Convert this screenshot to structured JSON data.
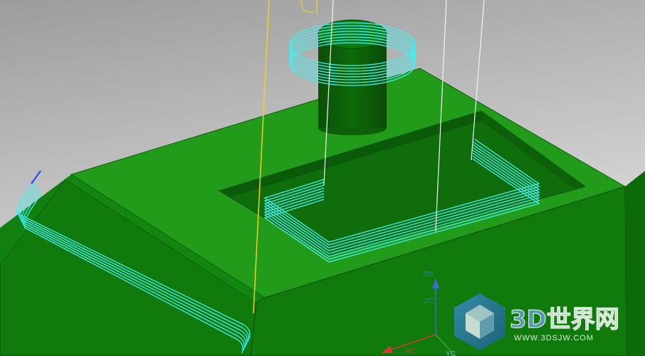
{
  "viewport": {
    "axes": {
      "zm_label": "ZM",
      "zc_label": "ZC",
      "xc_label": "XC",
      "yc_label": "YC",
      "z_color": "#3a6fd0",
      "x_color": "#d03a3a"
    },
    "colors": {
      "background_top": "#9e9e9e",
      "background_bottom": "#e2e2e2",
      "part_front": "#107a0c",
      "part_top": "#229a1a",
      "part_side": "#0d6a0a",
      "pocket_floor": "#0f6d0c",
      "boss": "#0a5a08",
      "toolpath": "#40f0f0",
      "tool_axis_yellow": "#f0d020",
      "tool_axis_white": "#f0f0f0"
    },
    "watermark": {
      "logo_text": "3D世界网",
      "url_text": "WWW.3DSJW.COM",
      "logo_icon": "cube-hexagon-icon"
    }
  }
}
